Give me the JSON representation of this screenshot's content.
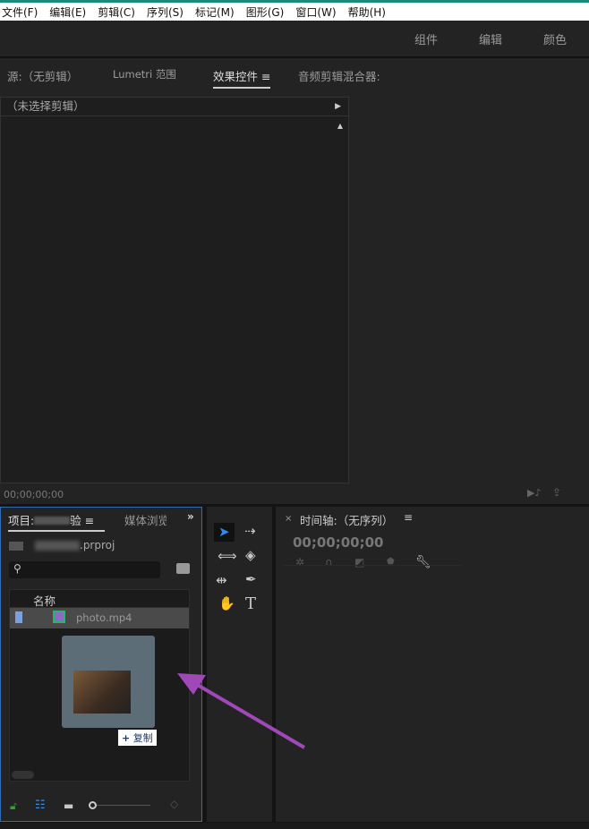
{
  "menu": [
    "文件(F)",
    "编辑(E)",
    "剪辑(C)",
    "序列(S)",
    "标记(M)",
    "图形(G)",
    "窗口(W)",
    "帮助(H)"
  ],
  "workspaces": [
    "组件",
    "编辑",
    "颜色"
  ],
  "upper_tabs": {
    "source": "源:（无剪辑）",
    "lumetri": "Lumetri 范围",
    "effects": "效果控件",
    "audio": "音频剪辑混合器:"
  },
  "effect_controls": {
    "no_clip": "（未选择剪辑）",
    "timecode": "00;00;00;00"
  },
  "project": {
    "tab_label": "项目:",
    "tab_suffix": "验",
    "media_tab": "媒体浏览",
    "file_suffix": ".prproj",
    "column_name": "名称",
    "item": "photo.mp4",
    "drag_tooltip": "复制",
    "drag_plus": "+"
  },
  "timeline": {
    "title": "时间轴:（无序列）",
    "timecode": "00;00;00;00",
    "close": "×"
  },
  "colors": {
    "accent_blue": "#2f6db5",
    "arrow": "#a048b8"
  }
}
